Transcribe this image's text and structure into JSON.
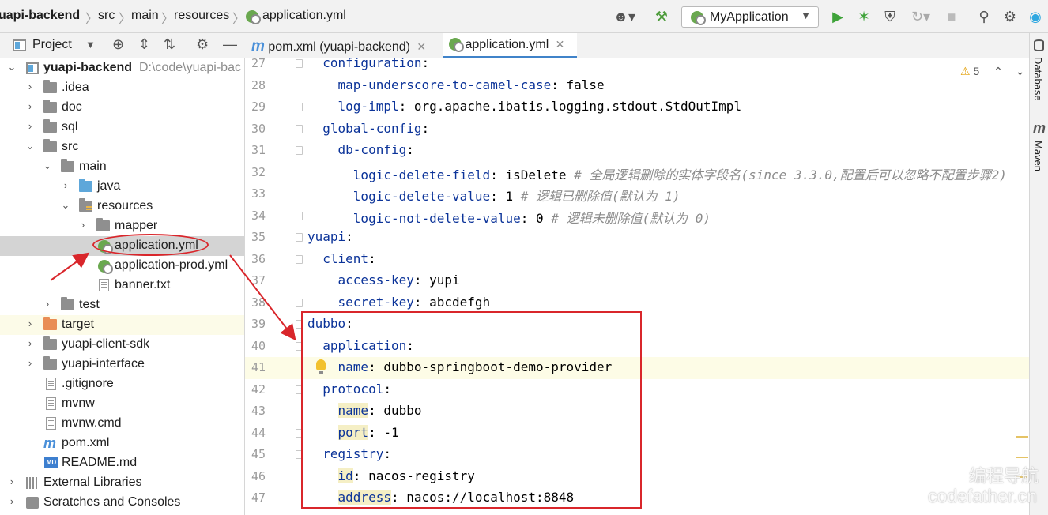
{
  "navbar": {
    "breadcrumbs": [
      "uapi-backend",
      "src",
      "main",
      "resources",
      "application.yml"
    ],
    "run_config": "MyApplication"
  },
  "project_panel": {
    "title": "Project",
    "tree": [
      {
        "label": "yuapi-backend",
        "hint": "D:\\code\\yuapi-bac",
        "icon": "module-folder-icon",
        "expanded": true
      },
      {
        "label": ".idea",
        "icon": "folder-icon",
        "expanded": false
      },
      {
        "label": "doc",
        "icon": "folder-icon",
        "expanded": false
      },
      {
        "label": "sql",
        "icon": "folder-icon",
        "expanded": false
      },
      {
        "label": "src",
        "icon": "folder-icon",
        "expanded": true
      },
      {
        "label": "main",
        "icon": "folder-icon",
        "expanded": true
      },
      {
        "label": "java",
        "icon": "source-folder-icon",
        "expanded": false
      },
      {
        "label": "resources",
        "icon": "resources-folder-icon",
        "expanded": true
      },
      {
        "label": "mapper",
        "icon": "folder-icon",
        "expanded": false
      },
      {
        "label": "application.yml",
        "icon": "yaml-file-icon",
        "selected": true
      },
      {
        "label": "application-prod.yml",
        "icon": "yaml-file-icon"
      },
      {
        "label": "banner.txt",
        "icon": "text-file-icon"
      },
      {
        "label": "test",
        "icon": "folder-icon",
        "expanded": false
      },
      {
        "label": "target",
        "icon": "excluded-folder-icon",
        "expanded": false
      },
      {
        "label": "yuapi-client-sdk",
        "icon": "folder-icon",
        "expanded": false
      },
      {
        "label": "yuapi-interface",
        "icon": "folder-icon",
        "expanded": false
      },
      {
        "label": ".gitignore",
        "icon": "gitignore-file-icon"
      },
      {
        "label": "mvnw",
        "icon": "file-icon"
      },
      {
        "label": "mvnw.cmd",
        "icon": "file-icon"
      },
      {
        "label": "pom.xml",
        "icon": "maven-file-icon"
      },
      {
        "label": "README.md",
        "icon": "markdown-file-icon"
      },
      {
        "label": "External Libraries",
        "icon": "libraries-icon",
        "expanded": false
      },
      {
        "label": "Scratches and Consoles",
        "icon": "scratches-icon",
        "expanded": false
      }
    ]
  },
  "tabs": [
    {
      "label": "pom.xml (yuapi-backend)",
      "active": false
    },
    {
      "label": "application.yml",
      "active": true
    }
  ],
  "editor": {
    "warning_count": "5",
    "lines": [
      {
        "n": "27",
        "indent": "  ",
        "key": "configuration",
        "sep": ":",
        "value": "",
        "comment": ""
      },
      {
        "n": "28",
        "indent": "    ",
        "key": "map-underscore-to-camel-case",
        "sep": ": ",
        "value": "false",
        "comment": ""
      },
      {
        "n": "29",
        "indent": "    ",
        "key": "log-impl",
        "sep": ": ",
        "value": "org.apache.ibatis.logging.stdout.StdOutImpl",
        "comment": ""
      },
      {
        "n": "30",
        "indent": "  ",
        "key": "global-config",
        "sep": ":",
        "value": "",
        "comment": ""
      },
      {
        "n": "31",
        "indent": "    ",
        "key": "db-config",
        "sep": ":",
        "value": "",
        "comment": ""
      },
      {
        "n": "32",
        "indent": "      ",
        "key": "logic-delete-field",
        "sep": ": ",
        "value": "isDelete",
        "comment": "# 全局逻辑删除的实体字段名(since 3.3.0,配置后可以忽略不配置步骤2)"
      },
      {
        "n": "33",
        "indent": "      ",
        "key": "logic-delete-value",
        "sep": ": ",
        "value": "1",
        "comment": "# 逻辑已删除值(默认为 1)"
      },
      {
        "n": "34",
        "indent": "      ",
        "key": "logic-not-delete-value",
        "sep": ": ",
        "value": "0",
        "comment": "# 逻辑未删除值(默认为 0)"
      },
      {
        "n": "35",
        "indent": "",
        "key": "yuapi",
        "sep": ":",
        "value": "",
        "comment": ""
      },
      {
        "n": "36",
        "indent": "  ",
        "key": "client",
        "sep": ":",
        "value": "",
        "comment": ""
      },
      {
        "n": "37",
        "indent": "    ",
        "key": "access-key",
        "sep": ": ",
        "value": "yupi",
        "comment": ""
      },
      {
        "n": "38",
        "indent": "    ",
        "key": "secret-key",
        "sep": ": ",
        "value": "abcdefgh",
        "comment": ""
      },
      {
        "n": "39",
        "indent": "",
        "key": "dubbo",
        "sep": ":",
        "value": "",
        "comment": ""
      },
      {
        "n": "40",
        "indent": "  ",
        "key": "application",
        "sep": ":",
        "value": "",
        "comment": ""
      },
      {
        "n": "41",
        "indent": "    ",
        "key": "name",
        "sep": ": ",
        "value": "dubbo-springboot-demo-provider",
        "comment": ""
      },
      {
        "n": "42",
        "indent": "  ",
        "key": "protocol",
        "sep": ":",
        "value": "",
        "comment": ""
      },
      {
        "n": "43",
        "indent": "    ",
        "key": "name",
        "sep": ": ",
        "value": "dubbo",
        "comment": ""
      },
      {
        "n": "44",
        "indent": "    ",
        "key": "port",
        "sep": ": ",
        "value": "-1",
        "comment": ""
      },
      {
        "n": "45",
        "indent": "  ",
        "key": "registry",
        "sep": ":",
        "value": "",
        "comment": ""
      },
      {
        "n": "46",
        "indent": "    ",
        "key": "id",
        "sep": ": ",
        "value": "nacos-registry",
        "comment": ""
      },
      {
        "n": "47",
        "indent": "    ",
        "key": "address",
        "sep": ": ",
        "value": "nacos://localhost:8848",
        "comment": ""
      }
    ]
  },
  "right_stripe": {
    "database": "Database",
    "maven": "Maven"
  },
  "watermark": {
    "line1": "编程导航",
    "line2": "codefather.cn"
  },
  "colors": {
    "annotation_red": "#d9262b",
    "selection": "#d4d4d4",
    "yaml_key": "#0b3399",
    "yaml_value": "#067d17",
    "comment": "#8c8c8c"
  }
}
